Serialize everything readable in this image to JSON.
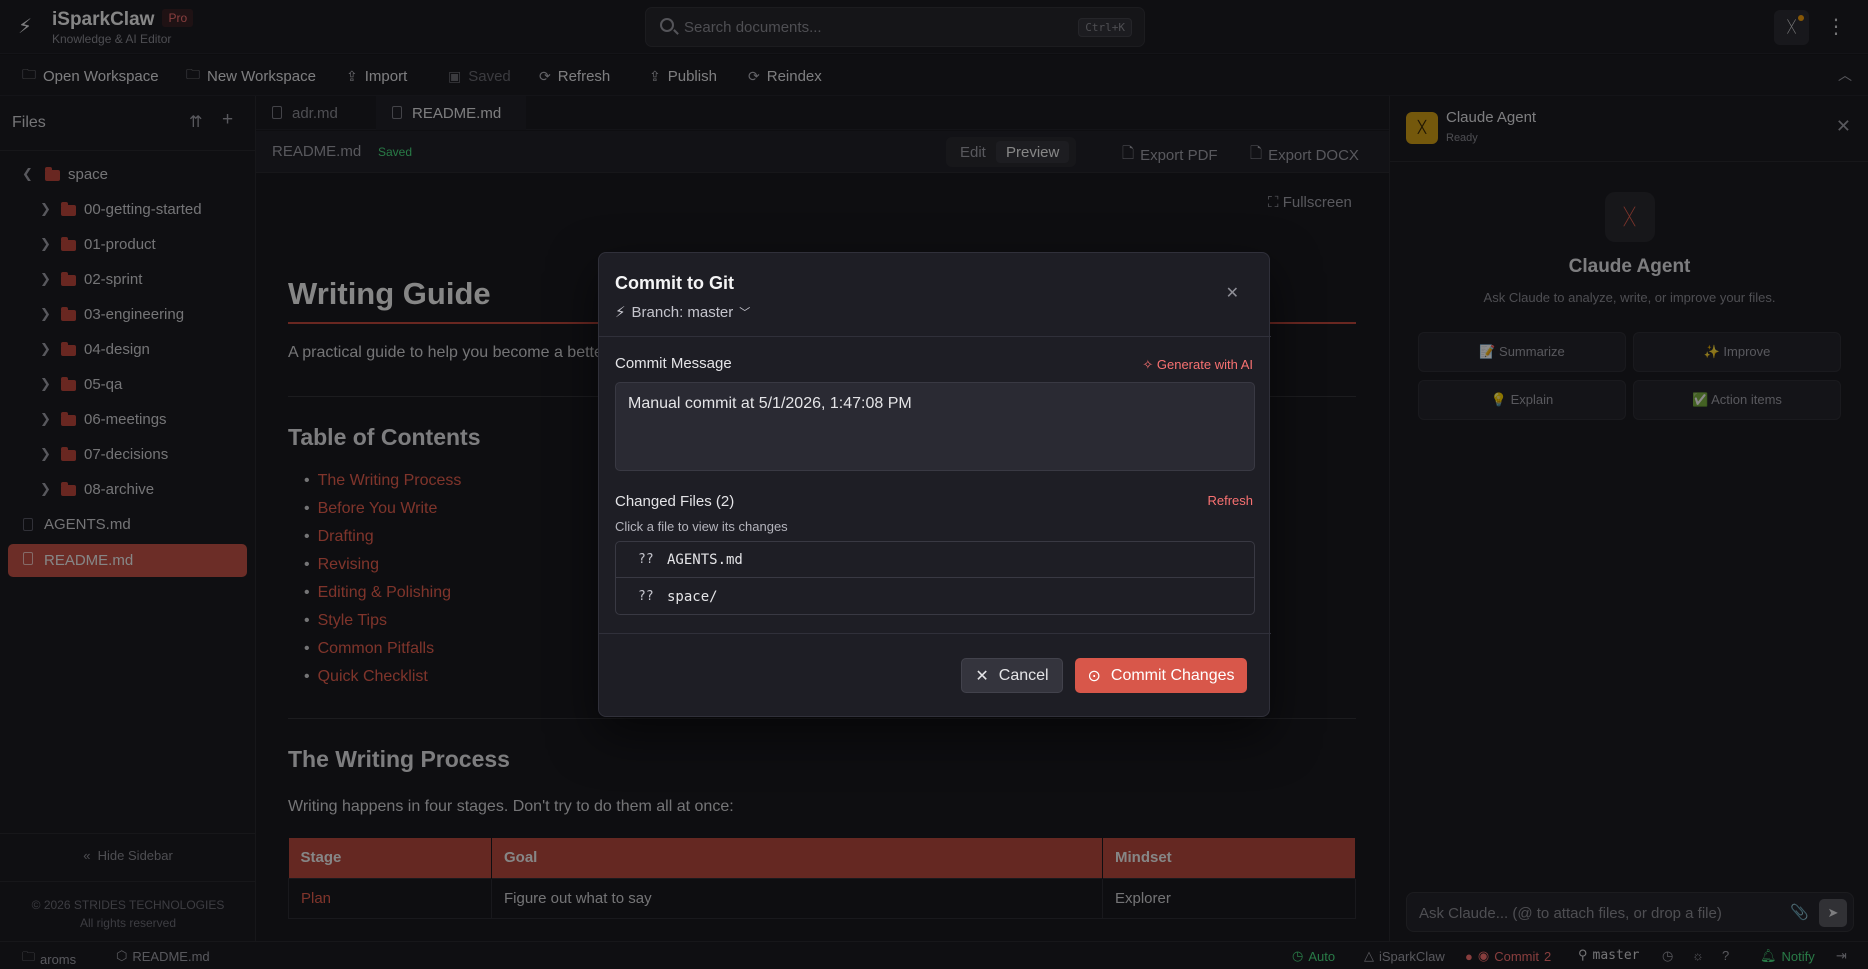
{
  "app": {
    "name": "iSparkClaw",
    "badge": "Pro",
    "subtitle": "Knowledge & AI Editor"
  },
  "search": {
    "placeholder": "Search documents...",
    "shortcut": "Ctrl+K"
  },
  "toolbar": {
    "open_workspace": "Open Workspace",
    "new_workspace": "New Workspace",
    "import": "Import",
    "saved": "Saved",
    "refresh": "Refresh",
    "publish": "Publish",
    "reindex": "Reindex"
  },
  "sidebar": {
    "title": "Files",
    "root": "space",
    "folders": [
      "00-getting-started",
      "01-product",
      "02-sprint",
      "03-engineering",
      "04-design",
      "05-qa",
      "06-meetings",
      "07-decisions",
      "08-archive"
    ],
    "files": [
      "AGENTS.md",
      "README.md"
    ],
    "hide_label": "Hide Sidebar",
    "copyright": "© 2026 STRIDES TECHNOLOGIES",
    "rights": "All rights reserved"
  },
  "editor": {
    "tabs": [
      "adr.md",
      "README.md"
    ],
    "current_file": "README.md",
    "saved_tag": "Saved",
    "mode_edit": "Edit",
    "mode_preview": "Preview",
    "export_pdf": "Export PDF",
    "export_docx": "Export DOCX",
    "fullscreen": "Fullscreen"
  },
  "doc": {
    "title": "Writing Guide",
    "lead": "A practical guide to help you become a better writer.",
    "toc_heading": "Table of Contents",
    "toc": [
      "The Writing Process",
      "Before You Write",
      "Drafting",
      "Revising",
      "Editing & Polishing",
      "Style Tips",
      "Common Pitfalls",
      "Quick Checklist"
    ],
    "section_heading": "The Writing Process",
    "section_text": "Writing happens in four stages. Don't try to do them all at once:",
    "table_headers": [
      "Stage",
      "Goal",
      "Mindset"
    ],
    "table_rows": [
      [
        "Plan",
        "Figure out what to say",
        "Explorer"
      ]
    ]
  },
  "agent": {
    "title": "Claude Agent",
    "status": "Ready",
    "hero_title": "Claude Agent",
    "hero_sub": "Ask Claude to analyze, write, or improve your files.",
    "quick": [
      "📝 Summarize",
      "✨ Improve",
      "💡 Explain",
      "✅ Action items"
    ],
    "input_placeholder": "Ask Claude... (@ to attach files, or drop a file)"
  },
  "statusbar": {
    "workspace": "aroms",
    "file": "README.md",
    "auto": "Auto",
    "app": "iSparkClaw",
    "commit_label": "Commit",
    "commit_count": "2",
    "branch": "master",
    "notify": "Notify"
  },
  "modal": {
    "title": "Commit to Git",
    "branch_label": "Branch: master",
    "message_label": "Commit Message",
    "generate": "Generate with AI",
    "message": "Manual commit at 5/1/2026, 1:47:08 PM",
    "changed_label": "Changed Files (2)",
    "refresh": "Refresh",
    "hint": "Click a file to view its changes",
    "files": [
      {
        "status": "??",
        "name": "AGENTS.md"
      },
      {
        "status": "??",
        "name": "space/"
      }
    ],
    "cancel": "Cancel",
    "commit": "Commit Changes"
  },
  "colors": {
    "accent": "#d8574a",
    "link": "#e8604f",
    "success": "#4ade80"
  }
}
